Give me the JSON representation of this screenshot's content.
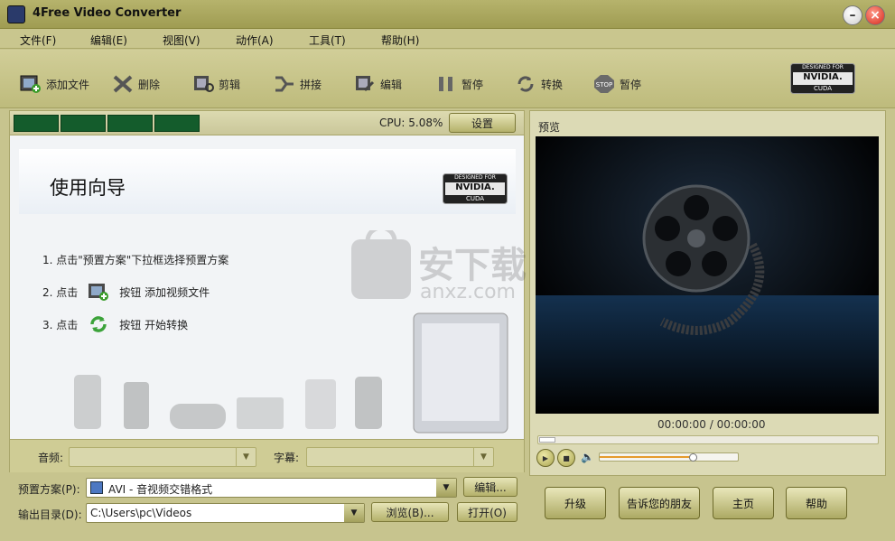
{
  "window": {
    "title": "4Free Video Converter"
  },
  "menu": [
    "文件(F)",
    "编辑(E)",
    "视图(V)",
    "动作(A)",
    "工具(T)",
    "帮助(H)"
  ],
  "toolbar": {
    "add_file": "添加文件",
    "delete": "删除",
    "crop": "剪辑",
    "join": "拼接",
    "edit": "编辑",
    "pause": "暂停",
    "convert": "转换",
    "stop": "暂停"
  },
  "cuda_badge": {
    "line1": "DESIGNED FOR",
    "line2": "NVIDIA.",
    "line3": "CUDA"
  },
  "status": {
    "cpu": "CPU: 5.08%",
    "settings": "设置"
  },
  "wizard": {
    "title": "使用向导",
    "step1": "1. 点击\"预置方案\"下拉框选择预置方案",
    "step2_pre": "2. 点击",
    "step2_post": "按钮 添加视频文件",
    "step3_pre": "3. 点击",
    "step3_post": "按钮 开始转换"
  },
  "watermark": {
    "cn": "安下载",
    "en": "anxz.com"
  },
  "audio": {
    "label": "音频:",
    "value": ""
  },
  "subtitle": {
    "label": "字幕:",
    "value": ""
  },
  "preset": {
    "label": "预置方案(P):",
    "value": "AVI - 音视频交错格式",
    "edit": "编辑..."
  },
  "output": {
    "label": "输出目录(D):",
    "value": "C:\\Users\\pc\\Videos",
    "browse": "浏览(B)...",
    "open": "打开(O)"
  },
  "preview": {
    "label": "预览",
    "time": "00:00:00 / 00:00:00",
    "volume": 0.68
  },
  "actions": {
    "upgrade": "升级",
    "tell_friend": "告诉您的朋友",
    "home": "主页",
    "help": "帮助"
  },
  "colors": {
    "accent": "#bebb7c",
    "progress": "#145c2c",
    "volume": "#e59b2d"
  }
}
